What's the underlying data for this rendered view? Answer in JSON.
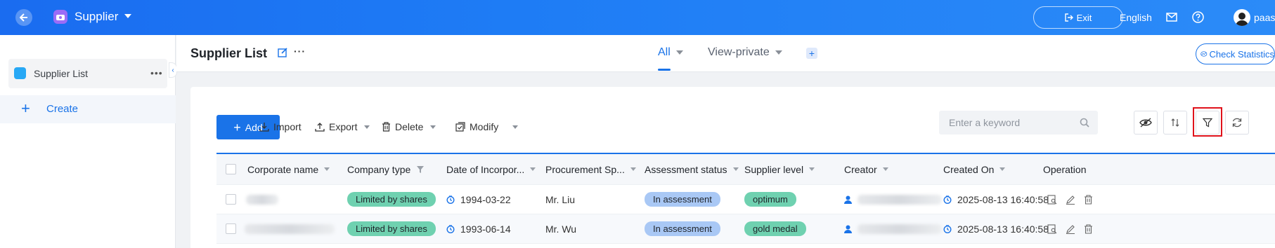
{
  "topbar": {
    "app_title": "Supplier",
    "exit_label": "Exit",
    "language": "English",
    "user_name": "paas",
    "colors": {
      "bar": "#1e7cf5",
      "app_icon": "#9b6cf7"
    }
  },
  "sidebar": {
    "items": [
      {
        "label": "Supplier List"
      }
    ],
    "create_label": "Create"
  },
  "header": {
    "title": "Supplier List",
    "tabs": [
      {
        "label": "All",
        "active": true
      },
      {
        "label": "View-private",
        "active": false
      }
    ],
    "check_stats_label": "Check Statistics"
  },
  "toolbar": {
    "add_label": "Add",
    "import_label": "Import",
    "export_label": "Export",
    "delete_label": "Delete",
    "modify_label": "Modify",
    "search_placeholder": "Enter a keyword"
  },
  "table": {
    "columns": [
      "Corporate name",
      "Company type",
      "Date of Incorpor...",
      "Procurement Sp...",
      "Assessment status",
      "Supplier level",
      "Creator",
      "Created On",
      "Operation"
    ],
    "rows": [
      {
        "company_type": "Limited by shares",
        "date": "1994-03-22",
        "procurement": "Mr. Liu",
        "assessment": "In assessment",
        "level": "optimum",
        "created_on": "2025-08-13 16:40:58"
      },
      {
        "company_type": "Limited by shares",
        "date": "1993-06-14",
        "procurement": "Mr. Wu",
        "assessment": "In assessment",
        "level": "gold medal",
        "created_on": "2025-08-13 16:40:58"
      }
    ]
  },
  "accent_color": "#1a73e8",
  "highlight_color": "#e0121b"
}
